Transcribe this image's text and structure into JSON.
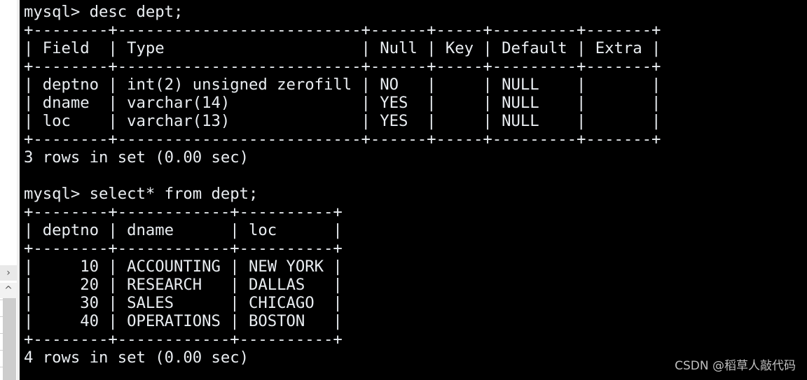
{
  "side_panel": {
    "expand_icon_label": "›",
    "scroll_up_icon_label": "^"
  },
  "terminal": {
    "lines": [
      "mysql> desc dept;",
      "+--------+--------------------------+------+-----+---------+-------+",
      "| Field  | Type                     | Null | Key | Default | Extra |",
      "+--------+--------------------------+------+-----+---------+-------+",
      "| deptno | int(2) unsigned zerofill | NO   |     | NULL    |       |",
      "| dname  | varchar(14)              | YES  |     | NULL    |       |",
      "| loc    | varchar(13)              | YES  |     | NULL    |       |",
      "+--------+--------------------------+------+-----+---------+-------+",
      "3 rows in set (0.00 sec)",
      "",
      "mysql> select* from dept;",
      "+--------+------------+----------+",
      "| deptno | dname      | loc      |",
      "+--------+------------+----------+",
      "|     10 | ACCOUNTING | NEW YORK |",
      "|     20 | RESEARCH   | DALLAS   |",
      "|     30 | SALES      | CHICAGO  |",
      "|     40 | OPERATIONS | BOSTON   |",
      "+--------+------------+----------+",
      "4 rows in set (0.00 sec)"
    ],
    "desc_table": {
      "columns": [
        "Field",
        "Type",
        "Null",
        "Key",
        "Default",
        "Extra"
      ],
      "rows": [
        [
          "deptno",
          "int(2) unsigned zerofill",
          "NO",
          "",
          "NULL",
          ""
        ],
        [
          "dname",
          "varchar(14)",
          "YES",
          "",
          "NULL",
          ""
        ],
        [
          "loc",
          "varchar(13)",
          "YES",
          "",
          "NULL",
          ""
        ]
      ],
      "status": "3 rows in set (0.00 sec)"
    },
    "select_table": {
      "columns": [
        "deptno",
        "dname",
        "loc"
      ],
      "rows": [
        [
          "10",
          "ACCOUNTING",
          "NEW YORK"
        ],
        [
          "20",
          "RESEARCH",
          "DALLAS"
        ],
        [
          "30",
          "SALES",
          "CHICAGO"
        ],
        [
          "40",
          "OPERATIONS",
          "BOSTON"
        ]
      ],
      "status": "4 rows in set (0.00 sec)"
    },
    "text_color": "#e9edf1",
    "background_color": "#000000"
  },
  "watermark": "CSDN @稻草人敲代码"
}
